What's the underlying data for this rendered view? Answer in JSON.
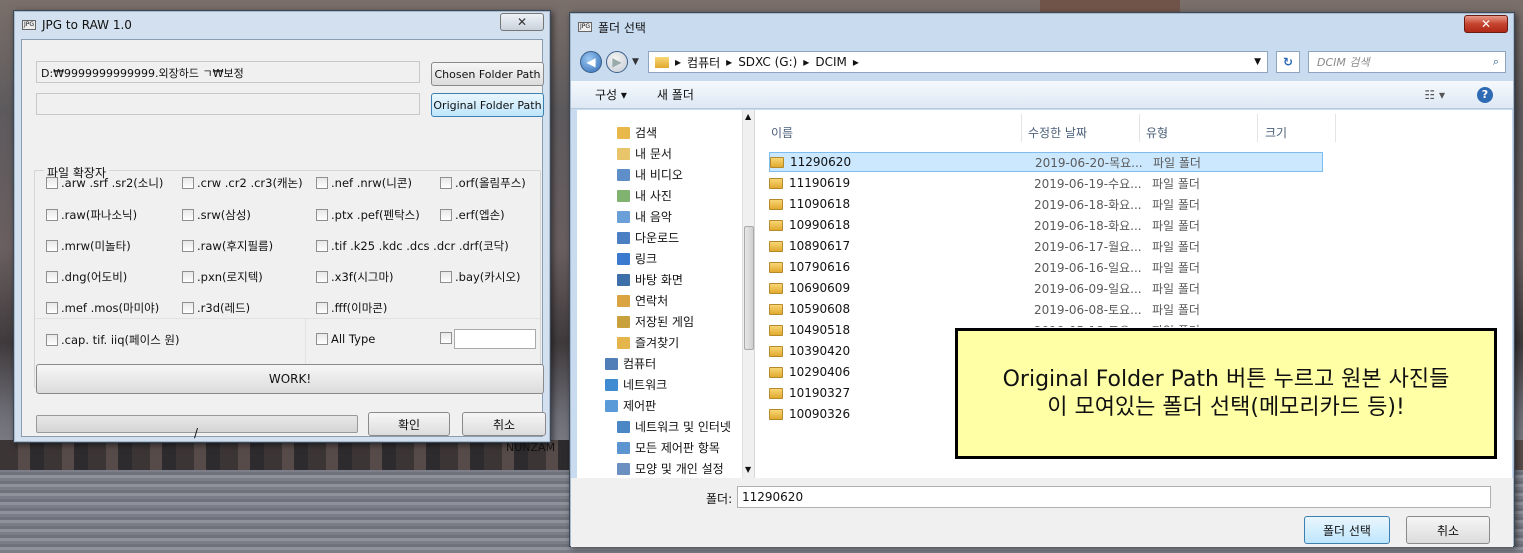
{
  "left_window": {
    "title": "JPG to RAW 1.0",
    "close": "✕",
    "chosen_path": "D:₩9999999999999.외장하드 ㄱ₩보정",
    "original_path": "",
    "chosen_btn": "Chosen Folder Path",
    "original_btn": "Original Folder Path",
    "group_title": "파일 확장자",
    "checks": [
      ".arw .srf .sr2(소니)",
      ".crw .cr2 .cr3(캐논)",
      ".nef .nrw(니콘)",
      ".orf(올림푸스)",
      ".raw(파나소닉)",
      ".srw(삼성)",
      ".ptx .pef(펜탁스)",
      ".erf(엡손)",
      ".mrw(미놀타)",
      ".raw(후지필름)",
      ".tif .k25 .kdc .dcs .dcr .drf(코닥)",
      ".dng(어도비)",
      ".pxn(로지텍)",
      ".x3f(시그마)",
      ".bay(카시오)",
      ".mef .mos(마미야)",
      ".r3d(레드)",
      ".fff(이마콘)",
      ".cap. tif. iiq(페이스 원)",
      "All Type"
    ],
    "custom_ext": "",
    "work": "WORK!",
    "confirm": "확인",
    "cancel": "취소",
    "progress_label": "/",
    "author": "NUNZAM"
  },
  "right_window": {
    "title": "폴더 선택",
    "close": "✕",
    "crumbs": [
      "컴퓨터",
      "SDXC (G:)",
      "DCIM"
    ],
    "search_placeholder": "DCIM 검색",
    "organize": "구성 ▾",
    "new_folder": "새 폴더",
    "nav_items": [
      "검색",
      "내 문서",
      "내 비디오",
      "내 사진",
      "내 음악",
      "다운로드",
      "링크",
      "바탕 화면",
      "연락처",
      "저장된 게임",
      "즐겨찾기",
      "컴퓨터",
      "네트워크",
      "제어판",
      "네트워크 및 인터넷",
      "모든 제어판 항목",
      "모양 및 개인 설정"
    ],
    "columns": {
      "name": "이름",
      "date": "수정한 날짜",
      "type": "유형",
      "size": "크기"
    },
    "rows": [
      {
        "name": "11290620",
        "date": "2019-06-20-목요...",
        "type": "파일 폴더"
      },
      {
        "name": "11190619",
        "date": "2019-06-19-수요...",
        "type": "파일 폴더"
      },
      {
        "name": "11090618",
        "date": "2019-06-18-화요...",
        "type": "파일 폴더"
      },
      {
        "name": "10990618",
        "date": "2019-06-18-화요...",
        "type": "파일 폴더"
      },
      {
        "name": "10890617",
        "date": "2019-06-17-월요...",
        "type": "파일 폴더"
      },
      {
        "name": "10790616",
        "date": "2019-06-16-일요...",
        "type": "파일 폴더"
      },
      {
        "name": "10690609",
        "date": "2019-06-09-일요...",
        "type": "파일 폴더"
      },
      {
        "name": "10590608",
        "date": "2019-06-08-토요...",
        "type": "파일 폴더"
      },
      {
        "name": "10490518",
        "date": "2019-05-18-토요...",
        "type": "파일 폴더"
      },
      {
        "name": "10390420",
        "date": "",
        "type": ""
      },
      {
        "name": "10290406",
        "date": "",
        "type": ""
      },
      {
        "name": "10190327",
        "date": "",
        "type": ""
      },
      {
        "name": "10090326",
        "date": "",
        "type": ""
      }
    ],
    "folder_label": "폴더:",
    "folder_value": "11290620",
    "select_btn": "폴더 선택",
    "cancel_btn": "취소"
  },
  "callout": {
    "line1": "Original Folder Path 버튼 누르고 원본 사진들",
    "line2": "이 모여있는 폴더 선택(메모리카드 등)!"
  },
  "colors": {
    "selection": "#cce8ff",
    "callout_bg": "#ffffa6",
    "title_bar": "#c9dcef"
  }
}
